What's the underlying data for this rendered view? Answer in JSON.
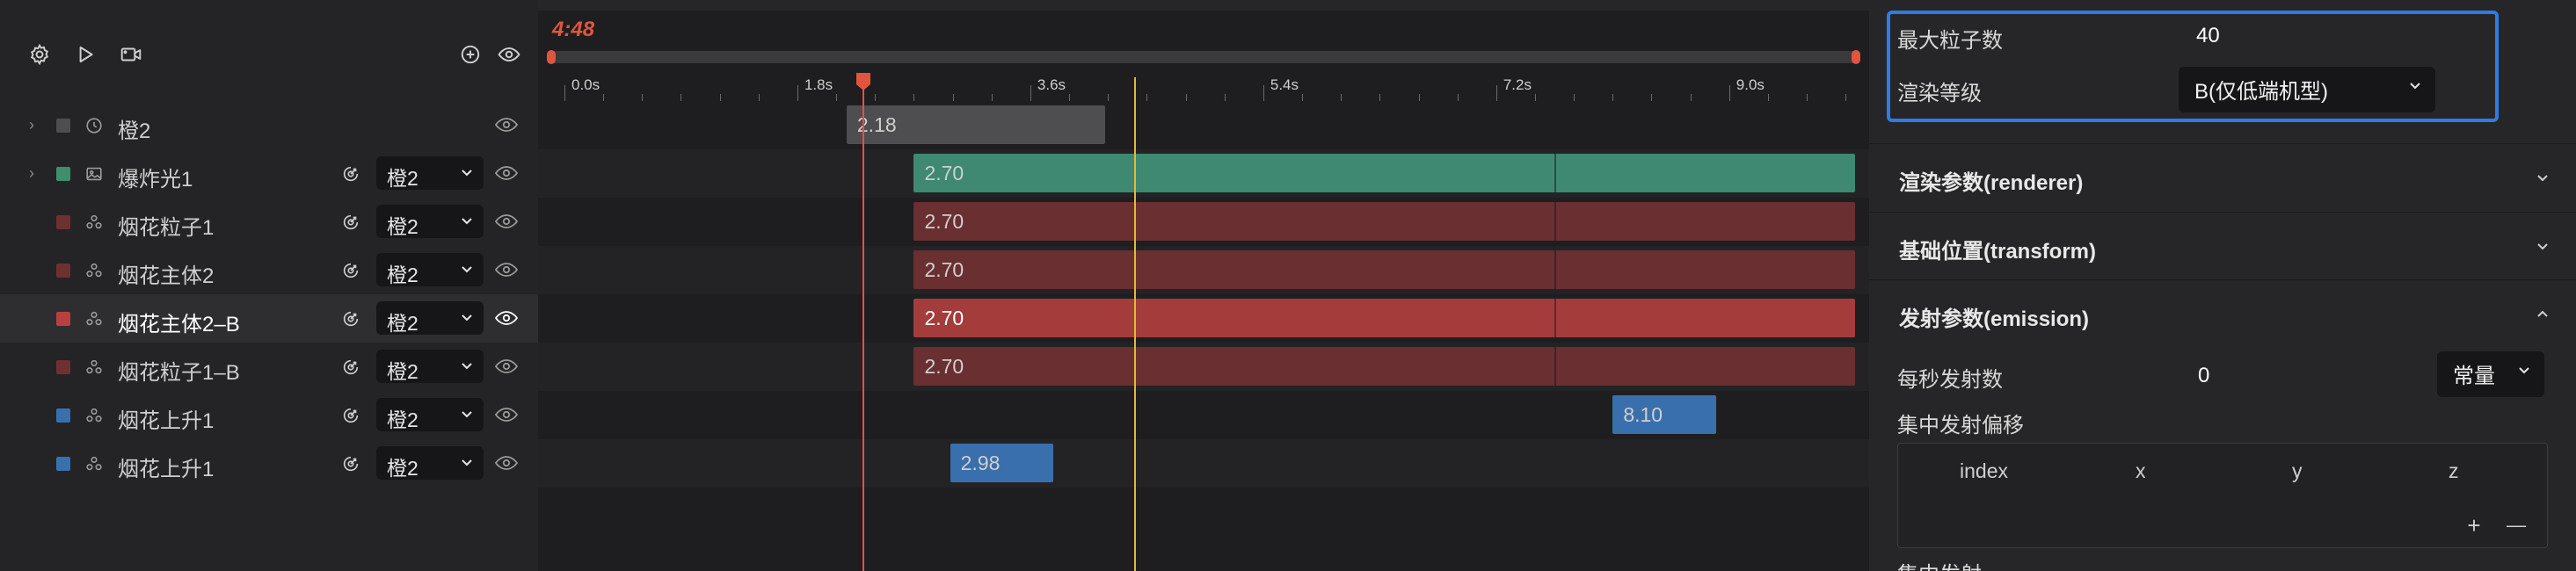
{
  "colors": {
    "accent": "#e2543d",
    "selection_border": "#2f7be6",
    "marker": "#e4b93a",
    "swatch_gray": "#4e4e50",
    "swatch_green": "#3f8f6f",
    "swatch_red_dim": "#6e3030",
    "swatch_red": "#b84040",
    "swatch_blue": "#3a6fae"
  },
  "toolbar": {
    "icons": [
      "gear-icon",
      "play-icon",
      "video-camera-icon",
      "add-circle-icon",
      "eye-icon"
    ]
  },
  "timeline": {
    "current_time": "4:48",
    "ticks": [
      "0.0s",
      "1.8s",
      "3.6s",
      "5.4s",
      "7.2s",
      "9.0s"
    ],
    "playhead_time": 2.3,
    "marker_time": 4.4
  },
  "layers": [
    {
      "name": "橙2",
      "type_icon": "clock-icon",
      "swatch": "#4e4e50",
      "expandable": true,
      "has_parent": false,
      "selected": false
    },
    {
      "name": "爆炸光1",
      "type_icon": "image-icon",
      "swatch": "#3f8f6f",
      "expandable": true,
      "has_parent": true,
      "parent": "橙2",
      "selected": false
    },
    {
      "name": "烟花粒子1",
      "type_icon": "particle-icon",
      "swatch": "#6e3030",
      "expandable": false,
      "has_parent": true,
      "parent": "橙2",
      "selected": false
    },
    {
      "name": "烟花主体2",
      "type_icon": "particle-icon",
      "swatch": "#6e3030",
      "expandable": false,
      "has_parent": true,
      "parent": "橙2",
      "selected": false
    },
    {
      "name": "烟花主体2–B",
      "type_icon": "particle-icon",
      "swatch": "#b84040",
      "expandable": false,
      "has_parent": true,
      "parent": "橙2",
      "selected": true
    },
    {
      "name": "烟花粒子1–B",
      "type_icon": "particle-icon",
      "swatch": "#6e3030",
      "expandable": false,
      "has_parent": true,
      "parent": "橙2",
      "selected": false
    },
    {
      "name": "烟花上升1",
      "type_icon": "particle-icon",
      "swatch": "#3a6fae",
      "expandable": false,
      "has_parent": true,
      "parent": "橙2",
      "selected": false
    },
    {
      "name": "烟花上升1",
      "type_icon": "particle-icon",
      "swatch": "#3a6fae",
      "expandable": false,
      "has_parent": true,
      "parent": "橙2",
      "selected": false
    }
  ],
  "clips": [
    {
      "label": "2.18",
      "start": 2.18,
      "end": 4.18,
      "color": "#4e4e50",
      "dividers": []
    },
    {
      "label": "2.70",
      "start": 2.7,
      "end": 10.0,
      "color": "#3f8872",
      "dividers": [
        7.65
      ]
    },
    {
      "label": "2.70",
      "start": 2.7,
      "end": 10.0,
      "color": "#6a2f30",
      "dividers": [
        7.65
      ]
    },
    {
      "label": "2.70",
      "start": 2.7,
      "end": 10.0,
      "color": "#6a2f30",
      "dividers": [
        7.65
      ]
    },
    {
      "label": "2.70",
      "start": 2.7,
      "end": 10.0,
      "color": "#a33c3b",
      "dividers": [
        7.65
      ],
      "selected": true
    },
    {
      "label": "2.70",
      "start": 2.7,
      "end": 10.0,
      "color": "#6a2f30",
      "dividers": [
        7.65
      ]
    },
    {
      "label": "8.10",
      "start": 8.1,
      "end": 8.9,
      "color": "#3a6fae",
      "dividers": []
    },
    {
      "label": "2.98",
      "start": 2.98,
      "end": 3.78,
      "color": "#3a6fae",
      "dividers": []
    }
  ],
  "inspector": {
    "max_particles_label": "最大粒子数",
    "max_particles_value": "40",
    "render_level_label": "渲染等级",
    "render_level_value": "B(仅低端机型)",
    "sections": {
      "renderer": "渲染参数(renderer)",
      "transform": "基础位置(transform)",
      "emission": "发射参数(emission)"
    },
    "emission": {
      "rate_label": "每秒发射数",
      "rate_value": "0",
      "rate_mode": "常量",
      "burst_offset_label": "集中发射偏移",
      "columns": [
        "index",
        "x",
        "y",
        "z"
      ],
      "add_symbol": "+",
      "remove_symbol": "—",
      "next_label": "集中发射"
    }
  }
}
